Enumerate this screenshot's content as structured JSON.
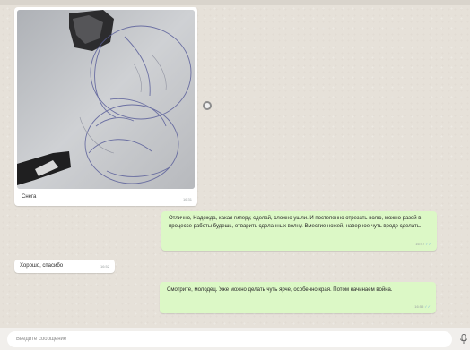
{
  "chat": {
    "messages": [
      {
        "kind": "photo",
        "direction": "incoming",
        "caption": "Снега",
        "time": "16:31"
      },
      {
        "kind": "text",
        "direction": "outgoing",
        "text": "Отлично, Надежда, какая гиперу, сделай, сложно ушли. И постепенно отрезать волю, можно разой в процессе работы будешь, отварить сделанных волну. Вместие ножей, наверное чуть вроде сделать.",
        "time": "16:47"
      },
      {
        "kind": "text",
        "direction": "incoming",
        "text": "Хорошо, спасибо",
        "time": "16:52"
      },
      {
        "kind": "text",
        "direction": "outgoing",
        "text": "Смотрите, молодец. Уже можно делать чуть ярче, особенно края. Потом начинаем война.",
        "time": "16:55"
      }
    ]
  },
  "composer": {
    "placeholder": "Введите сообщение"
  },
  "colors": {
    "chat_background": "#e6e1d9",
    "incoming_bubble": "#ffffff",
    "outgoing_bubble": "#dcf8c6",
    "read_check": "#7fb6d6"
  },
  "icons": {
    "typing": "loading-ring-icon",
    "mic": "microphone-icon"
  }
}
